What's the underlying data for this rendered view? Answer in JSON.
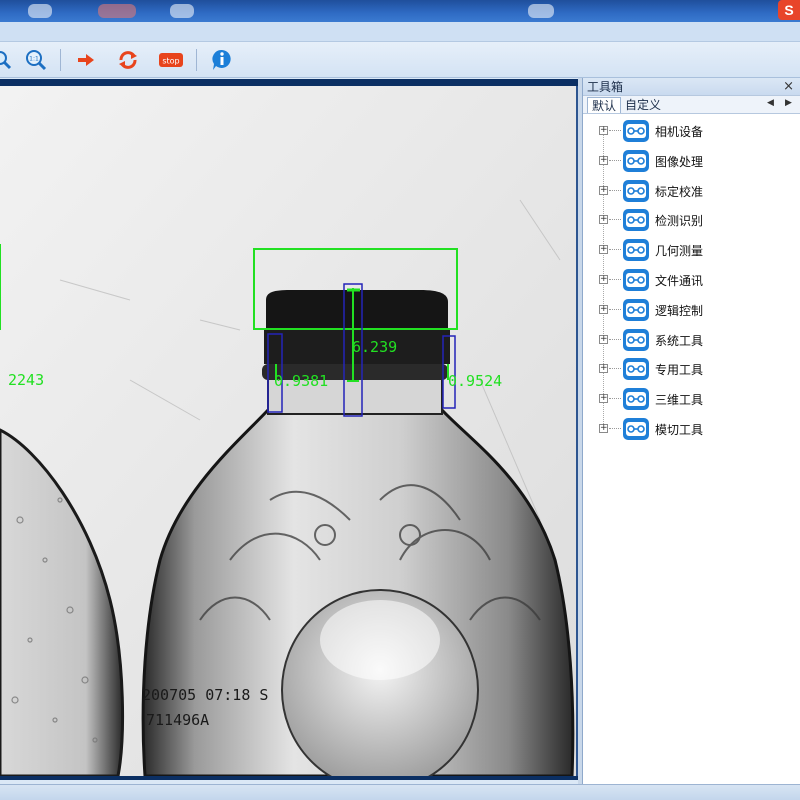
{
  "toolbar": {
    "buttons": [
      {
        "name": "zoom-in-icon"
      },
      {
        "name": "zoom-fit-icon"
      },
      {
        "name": "run-once-icon"
      },
      {
        "name": "run-loop-icon"
      },
      {
        "name": "stop-icon",
        "label": "stop"
      },
      {
        "name": "info-icon"
      }
    ],
    "stop_label": "stop",
    "fit_label": "1:1"
  },
  "measurements": {
    "left_width": "2243",
    "center_height": "6.239",
    "left_gap": "0.9381",
    "right_gap": "0.9524"
  },
  "bottle_print": {
    "line1": "200705 07:18 S",
    "line2": "711496A"
  },
  "toolbox": {
    "title": "工具箱",
    "close": "×",
    "tabs": [
      "默认",
      "自定义"
    ],
    "items": [
      {
        "label": "相机设备"
      },
      {
        "label": "图像处理"
      },
      {
        "label": "标定校准"
      },
      {
        "label": "检测识别"
      },
      {
        "label": "几何测量"
      },
      {
        "label": "文件通讯"
      },
      {
        "label": "逻辑控制"
      },
      {
        "label": "系统工具"
      },
      {
        "label": "专用工具"
      },
      {
        "label": "三维工具"
      },
      {
        "label": "模切工具"
      }
    ]
  },
  "colors": {
    "overlay_green": "#22e022",
    "overlay_blue": "#2222b8",
    "accent": "#1f7fd8"
  }
}
